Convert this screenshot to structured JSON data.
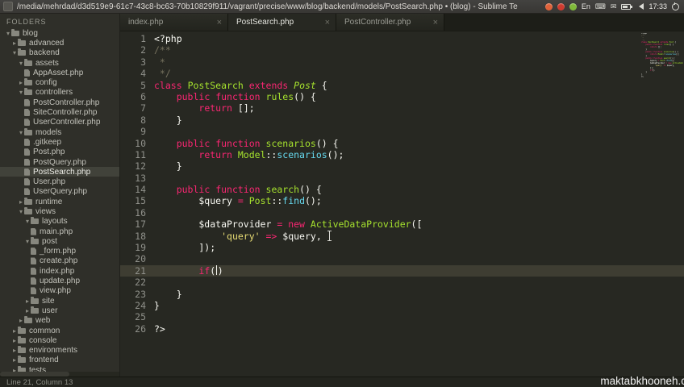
{
  "titlebar": {
    "title": "/media/mehrdad/d3d519e9-61c7-43c8-bc63-70b10829f911/vagrant/precise/www/blog/backend/models/PostSearch.php • (blog) - Sublime Te",
    "tray": [
      {
        "name": "indicator-dot-orange",
        "kind": "dot",
        "color": "#e0623a"
      },
      {
        "name": "indicator-dot-red",
        "kind": "dot",
        "color": "#cf3b2f"
      },
      {
        "name": "indicator-dot-green",
        "kind": "dot",
        "color": "#7fb939"
      },
      {
        "name": "keyboard-layout-badge",
        "kind": "text",
        "label": "En"
      },
      {
        "name": "keyboard-icon",
        "kind": "glyph",
        "glyph": "⌨"
      },
      {
        "name": "mail-icon",
        "kind": "glyph",
        "glyph": "✉"
      },
      {
        "name": "battery-icon",
        "kind": "battery"
      },
      {
        "name": "volume-icon",
        "kind": "speaker"
      },
      {
        "name": "clock",
        "kind": "text",
        "label": "17:33"
      },
      {
        "name": "power-icon",
        "kind": "power"
      }
    ]
  },
  "sidebar": {
    "header": "FOLDERS",
    "tree": [
      {
        "label": "blog",
        "type": "folder",
        "state": "open",
        "indent": 0
      },
      {
        "label": "advanced",
        "type": "folder",
        "state": "closed",
        "indent": 1
      },
      {
        "label": "backend",
        "type": "folder",
        "state": "open",
        "indent": 1
      },
      {
        "label": "assets",
        "type": "folder",
        "state": "open",
        "indent": 2
      },
      {
        "label": "AppAsset.php",
        "type": "file",
        "indent": 3
      },
      {
        "label": "config",
        "type": "folder",
        "state": "closed",
        "indent": 2
      },
      {
        "label": "controllers",
        "type": "folder",
        "state": "open",
        "indent": 2
      },
      {
        "label": "PostController.php",
        "type": "file",
        "indent": 3
      },
      {
        "label": "SiteController.php",
        "type": "file",
        "indent": 3
      },
      {
        "label": "UserController.php",
        "type": "file",
        "indent": 3
      },
      {
        "label": "models",
        "type": "folder",
        "state": "open",
        "indent": 2
      },
      {
        "label": ".gitkeep",
        "type": "file",
        "indent": 3
      },
      {
        "label": "Post.php",
        "type": "file",
        "indent": 3
      },
      {
        "label": "PostQuery.php",
        "type": "file",
        "indent": 3
      },
      {
        "label": "PostSearch.php",
        "type": "file",
        "indent": 3,
        "selected": true
      },
      {
        "label": "User.php",
        "type": "file",
        "indent": 3
      },
      {
        "label": "UserQuery.php",
        "type": "file",
        "indent": 3
      },
      {
        "label": "runtime",
        "type": "folder",
        "state": "closed",
        "indent": 2
      },
      {
        "label": "views",
        "type": "folder",
        "state": "open",
        "indent": 2
      },
      {
        "label": "layouts",
        "type": "folder",
        "state": "open",
        "indent": 3
      },
      {
        "label": "main.php",
        "type": "file",
        "indent": 4
      },
      {
        "label": "post",
        "type": "folder",
        "state": "open",
        "indent": 3
      },
      {
        "label": "_form.php",
        "type": "file",
        "indent": 4
      },
      {
        "label": "create.php",
        "type": "file",
        "indent": 4
      },
      {
        "label": "index.php",
        "type": "file",
        "indent": 4
      },
      {
        "label": "update.php",
        "type": "file",
        "indent": 4
      },
      {
        "label": "view.php",
        "type": "file",
        "indent": 4
      },
      {
        "label": "site",
        "type": "folder",
        "state": "closed",
        "indent": 3
      },
      {
        "label": "user",
        "type": "folder",
        "state": "closed",
        "indent": 3
      },
      {
        "label": "web",
        "type": "folder",
        "state": "closed",
        "indent": 2
      },
      {
        "label": "common",
        "type": "folder",
        "state": "closed",
        "indent": 1
      },
      {
        "label": "console",
        "type": "folder",
        "state": "closed",
        "indent": 1
      },
      {
        "label": "environments",
        "type": "folder",
        "state": "closed",
        "indent": 1
      },
      {
        "label": "frontend",
        "type": "folder",
        "state": "closed",
        "indent": 1
      },
      {
        "label": "tests",
        "type": "folder",
        "state": "closed",
        "indent": 1
      }
    ]
  },
  "tabs": [
    {
      "label": "index.php",
      "active": false
    },
    {
      "label": "PostSearch.php",
      "active": true
    },
    {
      "label": "PostController.php",
      "active": false
    }
  ],
  "editor": {
    "lines": [
      {
        "n": 1,
        "tokens": [
          [
            "p",
            "<?php"
          ]
        ]
      },
      {
        "n": 2,
        "tokens": [
          [
            "c",
            "/**"
          ]
        ]
      },
      {
        "n": 3,
        "tokens": [
          [
            "c",
            " *"
          ]
        ]
      },
      {
        "n": 4,
        "tokens": [
          [
            "c",
            " */"
          ]
        ]
      },
      {
        "n": 5,
        "tokens": [
          [
            "k",
            "class"
          ],
          [
            "p",
            " "
          ],
          [
            "n",
            "PostSearch"
          ],
          [
            "p",
            " "
          ],
          [
            "k",
            "extends"
          ],
          [
            "p",
            " "
          ],
          [
            "i",
            "Post"
          ],
          [
            "p",
            " {"
          ]
        ]
      },
      {
        "n": 6,
        "tokens": [
          [
            "p",
            "    "
          ],
          [
            "k",
            "public"
          ],
          [
            "p",
            " "
          ],
          [
            "k",
            "function"
          ],
          [
            "p",
            " "
          ],
          [
            "n",
            "rules"
          ],
          [
            "p",
            "() {"
          ]
        ]
      },
      {
        "n": 7,
        "tokens": [
          [
            "p",
            "        "
          ],
          [
            "k",
            "return"
          ],
          [
            "p",
            " [];"
          ]
        ]
      },
      {
        "n": 8,
        "tokens": [
          [
            "p",
            "    }"
          ]
        ]
      },
      {
        "n": 9,
        "tokens": []
      },
      {
        "n": 10,
        "tokens": [
          [
            "p",
            "    "
          ],
          [
            "k",
            "public"
          ],
          [
            "p",
            " "
          ],
          [
            "k",
            "function"
          ],
          [
            "p",
            " "
          ],
          [
            "n",
            "scenarios"
          ],
          [
            "p",
            "() {"
          ]
        ]
      },
      {
        "n": 11,
        "tokens": [
          [
            "p",
            "        "
          ],
          [
            "k",
            "return"
          ],
          [
            "p",
            " "
          ],
          [
            "n",
            "Model"
          ],
          [
            "p",
            "::"
          ],
          [
            "f",
            "scenarios"
          ],
          [
            "p",
            "();"
          ]
        ]
      },
      {
        "n": 12,
        "tokens": [
          [
            "p",
            "    }"
          ]
        ]
      },
      {
        "n": 13,
        "tokens": []
      },
      {
        "n": 14,
        "tokens": [
          [
            "p",
            "    "
          ],
          [
            "k",
            "public"
          ],
          [
            "p",
            " "
          ],
          [
            "k",
            "function"
          ],
          [
            "p",
            " "
          ],
          [
            "n",
            "search"
          ],
          [
            "p",
            "() {"
          ]
        ]
      },
      {
        "n": 15,
        "tokens": [
          [
            "p",
            "        $query "
          ],
          [
            "k",
            "="
          ],
          [
            "p",
            " "
          ],
          [
            "n",
            "Post"
          ],
          [
            "p",
            "::"
          ],
          [
            "f",
            "find"
          ],
          [
            "p",
            "();"
          ]
        ]
      },
      {
        "n": 16,
        "tokens": []
      },
      {
        "n": 17,
        "tokens": [
          [
            "p",
            "        $dataProvider "
          ],
          [
            "k",
            "="
          ],
          [
            "p",
            " "
          ],
          [
            "k",
            "new"
          ],
          [
            "p",
            " "
          ],
          [
            "n",
            "ActiveDataProvider"
          ],
          [
            "p",
            "(["
          ]
        ]
      },
      {
        "n": 18,
        "tokens": [
          [
            "p",
            "            "
          ],
          [
            "s",
            "'query'"
          ],
          [
            "p",
            " "
          ],
          [
            "k",
            "=>"
          ],
          [
            "p",
            " $query,"
          ]
        ]
      },
      {
        "n": 19,
        "tokens": [
          [
            "p",
            "        ]);"
          ]
        ]
      },
      {
        "n": 20,
        "tokens": []
      },
      {
        "n": 21,
        "current": true,
        "tokens": [
          [
            "p",
            "        "
          ],
          [
            "k",
            "if"
          ],
          [
            "p",
            "("
          ],
          [
            "caret",
            ""
          ],
          [
            "p",
            ")"
          ]
        ]
      },
      {
        "n": 22,
        "tokens": []
      },
      {
        "n": 23,
        "tokens": [
          [
            "p",
            "    }"
          ]
        ]
      },
      {
        "n": 24,
        "tokens": [
          [
            "p",
            "}"
          ]
        ]
      },
      {
        "n": 25,
        "tokens": []
      },
      {
        "n": 26,
        "tokens": [
          [
            "p",
            "?>"
          ]
        ]
      }
    ]
  },
  "status": {
    "left": "Line 21, Column 13"
  },
  "watermark": {
    "text": "maktabkhooneh.c"
  },
  "colors": {
    "keyword": "#f92672",
    "entity": "#a6e22e",
    "support": "#66d9ef",
    "string": "#e6db74",
    "comment": "#75715e",
    "plain": "#f8f8f2",
    "editor_bg": "#272822",
    "current_line": "#3e3d32",
    "sidebar_selection": "#41423a"
  }
}
